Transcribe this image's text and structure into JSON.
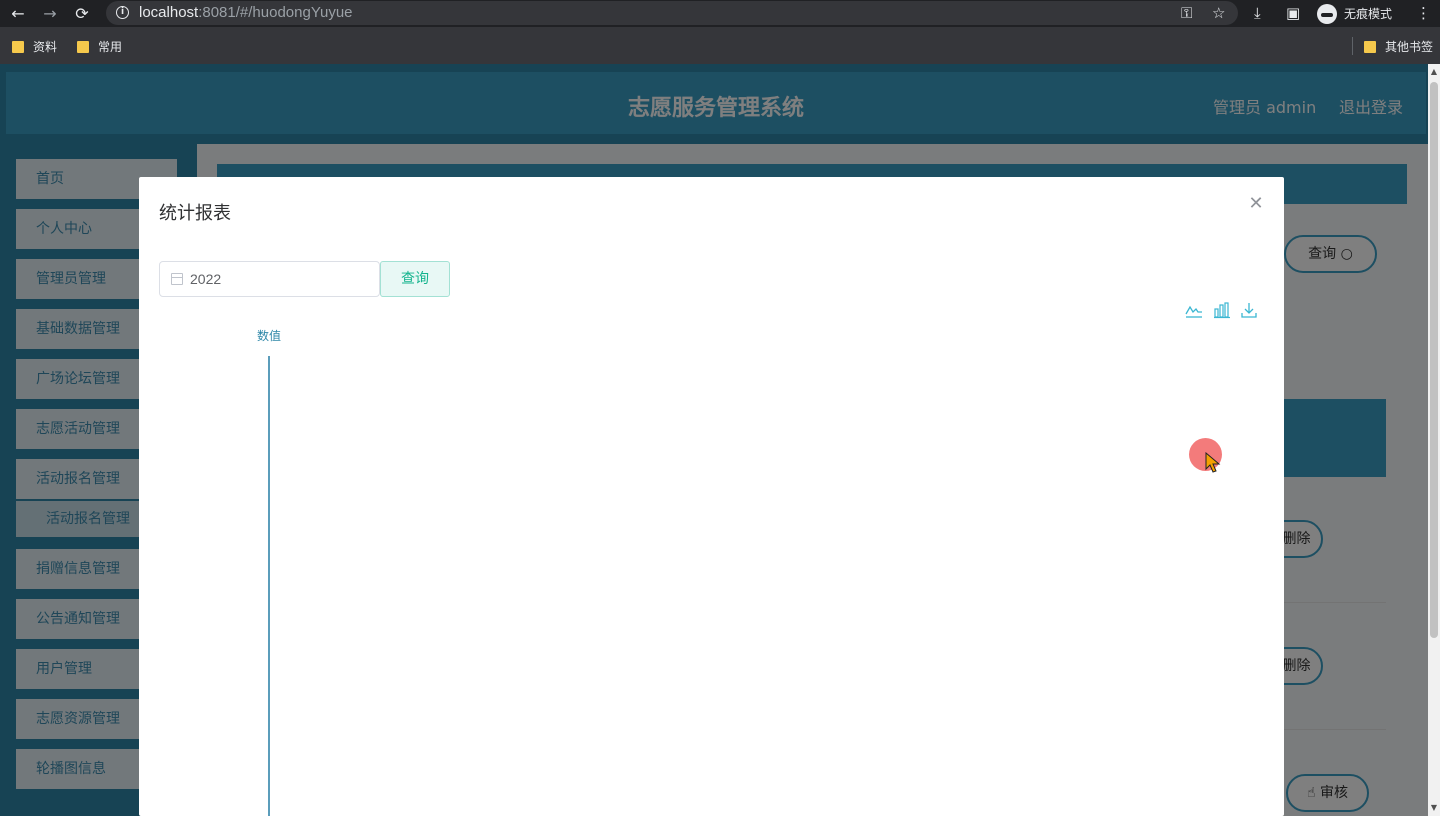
{
  "browser": {
    "url_host": "localhost",
    "url_rest": ":8081/#/huodongYuyue",
    "incognito_label": "无痕模式",
    "bookmarks": [
      "资料",
      "常用"
    ],
    "other_bookmarks": "其他书签"
  },
  "app": {
    "title": "志愿服务管理系统",
    "user": "管理员 admin",
    "logout": "退出登录"
  },
  "sidebar": {
    "items": [
      "首页",
      "个人中心",
      "管理员管理",
      "基础数据管理",
      "广场论坛管理",
      "志愿活动管理",
      "活动报名管理"
    ],
    "sub_item": "活动报名管理",
    "items_after": [
      "捐赠信息管理",
      "公告通知管理",
      "用户管理",
      "志愿资源管理",
      "轮播图信息"
    ]
  },
  "content": {
    "search_button": "查询",
    "delete_button": "删除",
    "audit_button": "审核"
  },
  "dialog": {
    "title": "统计报表",
    "date_value": "2022",
    "query_button": "查询",
    "chart_data": {
      "type": "bar",
      "ylabel": "数值",
      "categories": [],
      "series": []
    }
  },
  "colors": {
    "primary": "#3b9ec5",
    "accent_green": "#13b38d",
    "sidebar_text": "#3e8db0"
  }
}
